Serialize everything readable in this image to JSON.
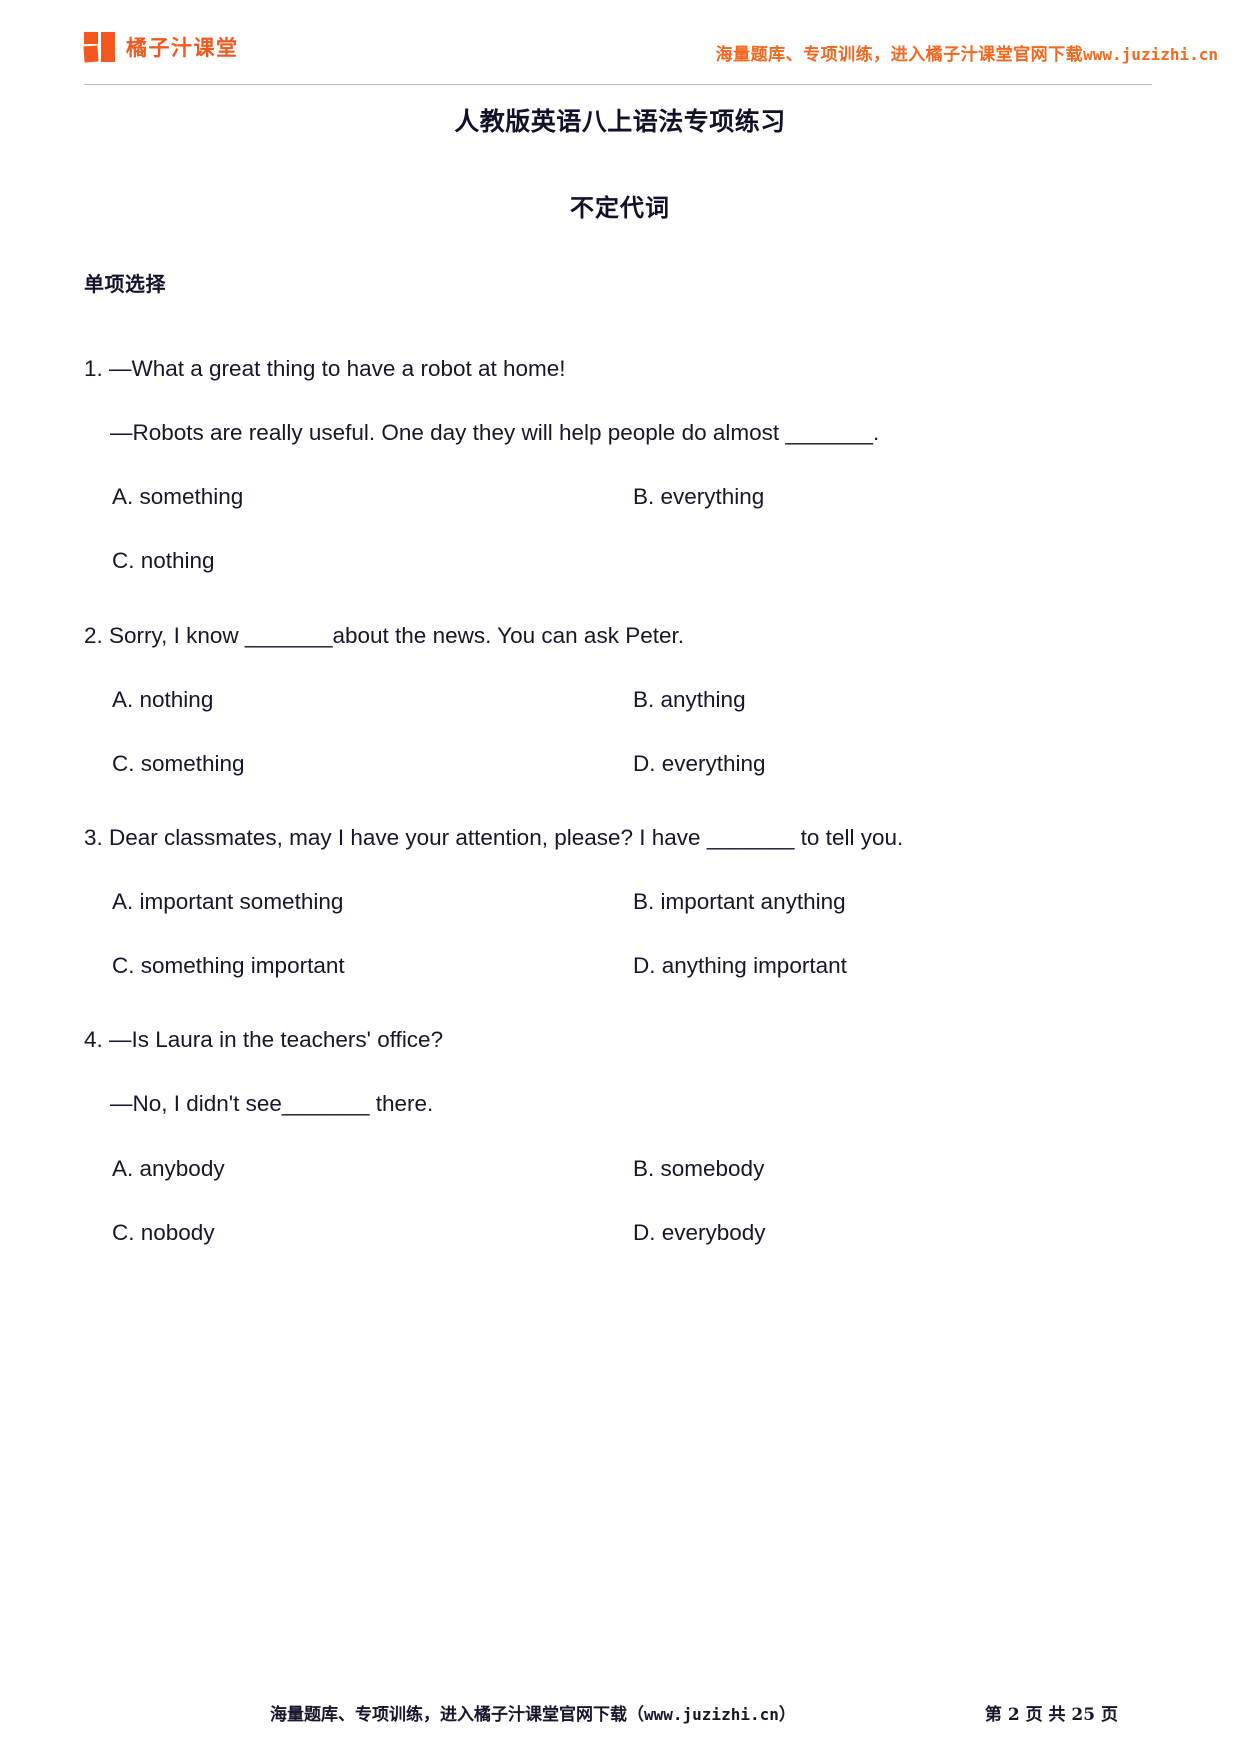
{
  "header": {
    "brand_name": "橘子汁课堂",
    "brand_icon": "orange-juice-logo-squares",
    "promo_text": "海量题库、专项训练，进入橘子汁课堂官网下载",
    "promo_url": "www.juzizhi.cn",
    "accent_color": "#f4581f"
  },
  "document": {
    "title": "人教版英语八上语法专项练习",
    "subtitle": "不定代词",
    "section_label": "单项选择"
  },
  "questions": [
    {
      "number": "1.",
      "lines": [
        "1. —What a great thing to have a robot at home!",
        "—Robots are really useful. One day they will help people do almost _______."
      ],
      "options": [
        "A. something",
        "B. everything",
        "C. nothing"
      ]
    },
    {
      "number": "2.",
      "lines": [
        "2. Sorry, I know _______about the news. You can ask Peter."
      ],
      "options": [
        "A. nothing",
        "B. anything",
        "C. something",
        "D. everything"
      ]
    },
    {
      "number": "3.",
      "lines": [
        "3. Dear classmates, may I have your attention, please? I have _______ to tell you."
      ],
      "options": [
        "A. important something",
        "B. important anything",
        "C. something important",
        "D. anything important"
      ]
    },
    {
      "number": "4.",
      "lines": [
        "4. —Is Laura in the teachers' office?",
        "—No, I didn't see_______ there."
      ],
      "options": [
        "A. anybody",
        "B. somebody",
        "C. nobody",
        "D. everybody"
      ]
    }
  ],
  "footer": {
    "promo_text": "海量题库、专项训练，进入橘子汁课堂官网下载（",
    "promo_url": "www.juzizhi.cn",
    "promo_text_end": "）",
    "page_indicator": "第 2 页 共 25 页"
  }
}
